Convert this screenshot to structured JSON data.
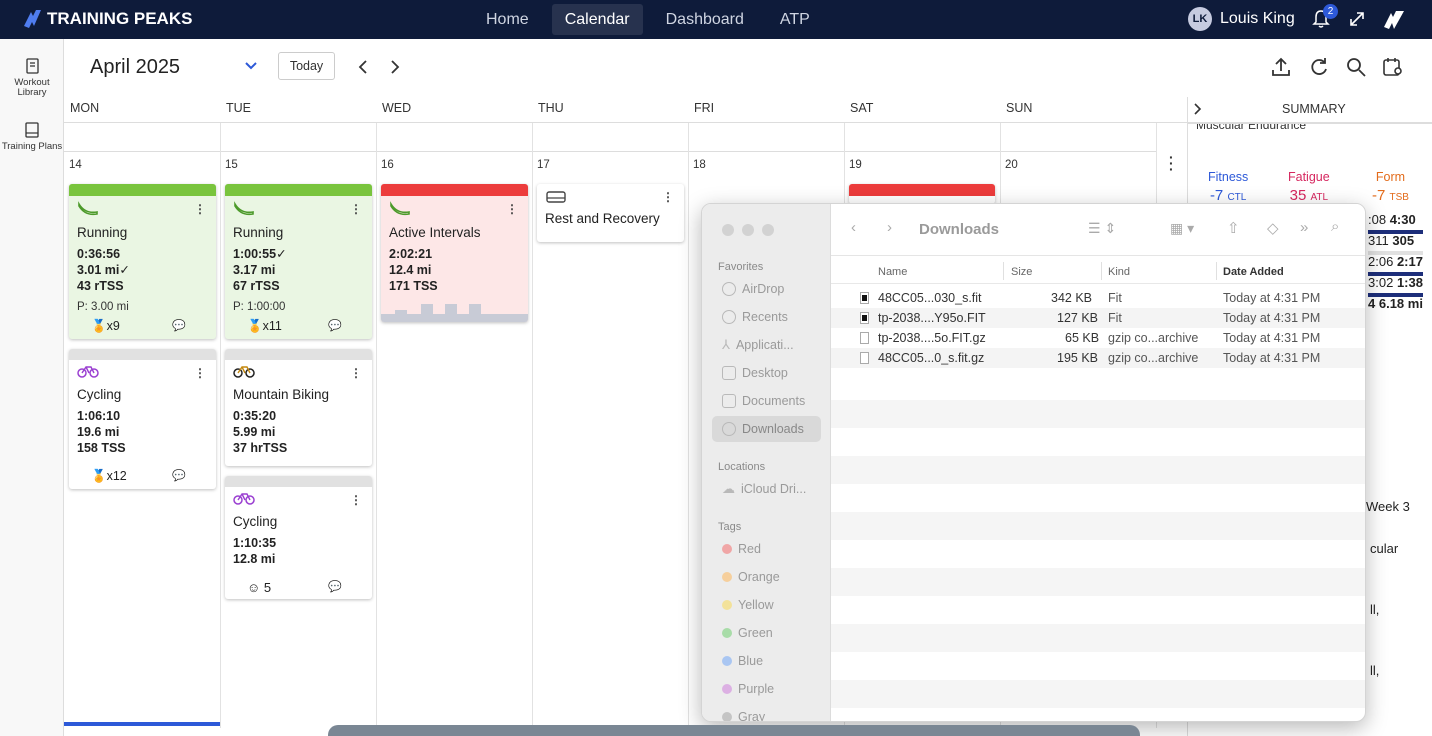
{
  "app": {
    "brand": "TRAINING PEAKS",
    "nav": [
      "Home",
      "Calendar",
      "Dashboard",
      "ATP"
    ],
    "active_nav": "Calendar",
    "user_name": "Louis King",
    "notification_count": "2"
  },
  "sidebar": {
    "workout_library": "Workout Library",
    "training_plans": "Training Plans"
  },
  "calendar": {
    "month": "April 2025",
    "today_label": "Today",
    "days": [
      "MON",
      "TUE",
      "WED",
      "THU",
      "FRI",
      "SAT",
      "SUN"
    ],
    "dates": [
      "14",
      "15",
      "16",
      "17",
      "18",
      "19",
      "20"
    ]
  },
  "workouts": {
    "mon_run": {
      "title": "Running",
      "duration": "0:36:56",
      "distance": "3.01 mi",
      "check": "✓",
      "tss": "43 rTSS",
      "planned": "P: 3.00 mi",
      "pr": "x9"
    },
    "mon_cycle": {
      "title": "Cycling",
      "duration": "1:06:10",
      "distance": "19.6 mi",
      "tss": "158 TSS",
      "pr": "x12"
    },
    "tue_run": {
      "title": "Running",
      "duration": "1:00:55",
      "check": "✓",
      "distance": "3.17 mi",
      "tss": "67 rTSS",
      "planned": "P: 1:00:00",
      "pr": "x11"
    },
    "tue_mtb": {
      "title": "Mountain Biking",
      "duration": "0:35:20",
      "distance": "5.99 mi",
      "tss": "37 hrTSS"
    },
    "tue_cycle": {
      "title": "Cycling",
      "duration": "1:10:35",
      "distance": "12.8 mi",
      "feel": "5"
    },
    "wed_intervals": {
      "title": "Active Intervals",
      "duration": "2:02:21",
      "distance": "12.4 mi",
      "tss": "171 TSS"
    },
    "thu_rest": {
      "title": "Rest and Recovery"
    }
  },
  "summary": {
    "header": "SUMMARY",
    "top_partial": "Muscular Endurance",
    "fitness_label": "Fitness",
    "fitness_value": "-7",
    "fitness_unit": "CTL",
    "fatigue_label": "Fatigue",
    "fatigue_value": "35",
    "fatigue_unit": "ATL",
    "form_label": "Form",
    "form_value": "-7",
    "form_unit": "TSB",
    "row1_a": ":08",
    "row1_b": "4:30",
    "row2_a": "311",
    "row2_b": "305",
    "row3_a": "2:06",
    "row3_b": "2:17",
    "row4_a": "3:02",
    "row4_b": "1:38",
    "row5_a": "4",
    "row5_b": "6.18 mi",
    "week": "Week 3",
    "frag1": "cular",
    "frag2": "ll,",
    "frag3": "ll,"
  },
  "finder": {
    "title": "Downloads",
    "favorites_label": "Favorites",
    "favorites": [
      "AirDrop",
      "Recents",
      "Applicati...",
      "Desktop",
      "Documents",
      "Downloads"
    ],
    "locations_label": "Locations",
    "locations": [
      "iCloud Dri..."
    ],
    "tags_label": "Tags",
    "tags": [
      "Red",
      "Orange",
      "Yellow",
      "Green",
      "Blue",
      "Purple",
      "Gray"
    ],
    "tag_colors": [
      "#f0a6a6",
      "#f6cf9c",
      "#f3e29a",
      "#a8dca8",
      "#a9c6f2",
      "#dcb0e3",
      "#c4c4c4"
    ],
    "columns": {
      "name": "Name",
      "size": "Size",
      "kind": "Kind",
      "date": "Date Added"
    },
    "files": [
      {
        "name": "48CC05...030_s.fit",
        "size": "342 KB",
        "kind": "Fit",
        "date": "Today at 4:31 PM"
      },
      {
        "name": "tp-2038....Y95o.FIT",
        "size": "127 KB",
        "kind": "Fit",
        "date": "Today at 4:31 PM"
      },
      {
        "name": "tp-2038....5o.FIT.gz",
        "size": "65 KB",
        "kind": "gzip co...archive",
        "date": "Today at 4:31 PM"
      },
      {
        "name": "48CC05...0_s.fit.gz",
        "size": "195 KB",
        "kind": "gzip co...archive",
        "date": "Today at 4:31 PM"
      }
    ]
  }
}
